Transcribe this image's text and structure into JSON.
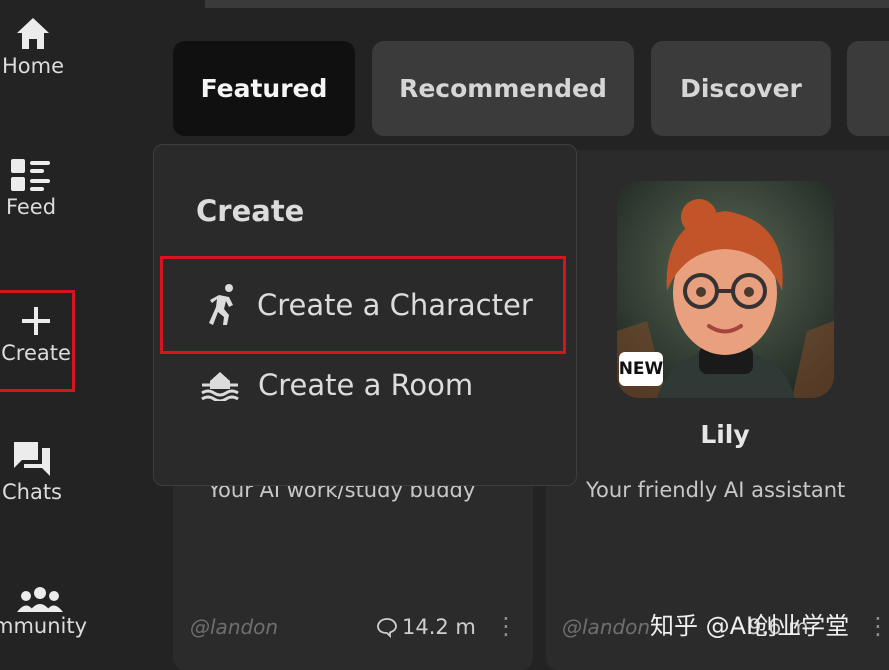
{
  "sidebar": {
    "items": [
      {
        "label": "Home",
        "icon": "home-icon"
      },
      {
        "label": "Feed",
        "icon": "feed-icon"
      },
      {
        "label": "Create",
        "icon": "plus-icon"
      },
      {
        "label": "Chats",
        "icon": "chat-icon"
      },
      {
        "label": "mmunity",
        "icon": "community-icon"
      }
    ]
  },
  "tabs": [
    {
      "label": "Featured",
      "active": true
    },
    {
      "label": "Recommended"
    },
    {
      "label": "Discover"
    }
  ],
  "dropdown": {
    "title": "Create",
    "items": [
      {
        "label": "Create a Character",
        "icon": "character-icon",
        "highlighted": true
      },
      {
        "label": "Create a Room",
        "icon": "room-icon"
      }
    ]
  },
  "cards": [
    {
      "description": "Your AI work/study buddy",
      "author": "@landon",
      "count": "14.2 m"
    },
    {
      "name": "Lily",
      "badge": "NEW",
      "description": "Your friendly AI assistant",
      "author": "@landon",
      "count": "9.6 m"
    }
  ],
  "watermark": "知乎 @AI创业学堂",
  "colors": {
    "highlight": "#d4141e",
    "background": "#232323",
    "active_tab": "#101010"
  }
}
